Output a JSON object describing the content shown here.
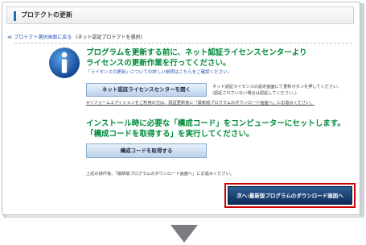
{
  "header": {
    "title": "プロテクトの更新"
  },
  "breadcrumb": {
    "back": "≪ プロテクト選択画面に戻る",
    "current": "(ネット認証プロテクトを選択)"
  },
  "section1": {
    "heading_line1": "プログラムを更新する前に、ネット認証ライセンスセンターより",
    "heading_line2": "ライセンスの更新作業を行ってください。",
    "detail_link": "「ライセンスの更新」についての詳しい説明はこちらをご確認ください。",
    "button_label": "ネット認証ライセンスセンターを開く",
    "side_note_line1": "ネット認証ライセンスの設定画面にて更新ボタンを押してください。",
    "side_note_line2": "(認証されていない場合は認証してください。)",
    "reform_note": "※リフォームエディションをご利用の方は、認証更新後に「最新版プログラムのダウンロード画面へ」にお進みください。"
  },
  "section2": {
    "heading_line1": "インストール時に必要な「構成コード」をコンピューターにセットします。",
    "heading_line2": "「構成コードを取得する」を実行してください。",
    "button_label": "構成コードを取得する",
    "after_note": "上記の操作後、「最新版プログラムのダウンロード画面へ」にお進みください。"
  },
  "next_button": {
    "label": "次へ:最新版プログラムのダウンロード画面へ"
  },
  "colors": {
    "accent_green": "#008b3a",
    "link_blue": "#2b56b8",
    "highlight_red": "#cc0000",
    "button_navy": "#0e2c57"
  },
  "icons": {
    "info": "info-icon",
    "arrow": "down-arrow-icon"
  }
}
